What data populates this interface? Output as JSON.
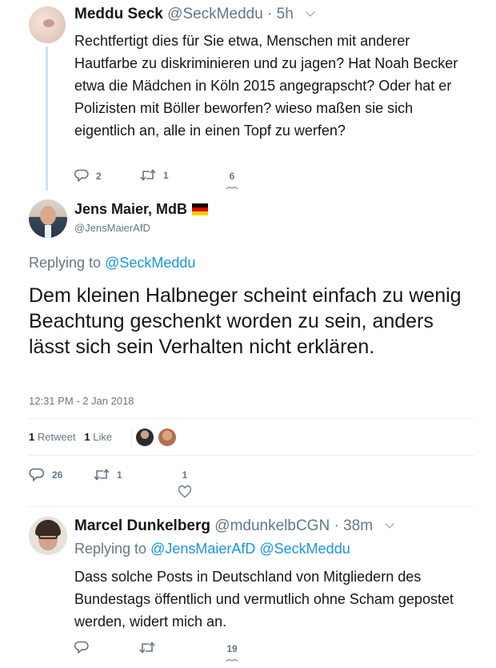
{
  "reply_top": {
    "name": "Meddu Seck",
    "handle": "@SeckMeddu",
    "separator": "·",
    "time": "5h",
    "text": "Rechtfertigt dies für Sie etwa, Menschen mit anderer Hautfarbe zu diskriminieren und zu jagen? Hat Noah Becker etwa die Mädchen in Köln 2015 angegrapscht? Oder hat er Polizisten mit Böller beworfen? wieso maßen sie sich eigentlich an, alle in einen Topf zu werfen?",
    "replies": "2",
    "retweets": "1",
    "likes": "6"
  },
  "main_tweet": {
    "name": "Jens Maier, MdB",
    "handle": "@JensMaierAfD",
    "replying_prefix": "Replying to",
    "replying_handle": "@SeckMeddu",
    "text": "Dem kleinen Halbneger scheint einfach zu wenig Beachtung geschenkt worden zu sein, anders lässt sich sein Verhalten nicht erklären.",
    "timestamp": "12:31 PM - 2 Jan 2018",
    "retweet_count": "1",
    "retweet_label": "Retweet",
    "like_count": "1",
    "like_label": "Like",
    "replies": "26",
    "retweets": "1",
    "likes": "1"
  },
  "reply_bottom": {
    "name": "Marcel Dunkelberg",
    "handle": "@mdunkelbCGN",
    "separator": "·",
    "time": "38m",
    "replying_prefix": "Replying to",
    "replying_handles": "@JensMaierAfD @SeckMeddu",
    "text": "Dass solche Posts in Deutschland von Mitgliedern des Bundestags öffentlich und vermutlich ohne Scham gepostet werden, widert mich an.",
    "likes": "19"
  },
  "colors": {
    "link": "#1b95e0",
    "muted": "#657786",
    "thread_line": "#cde3f7"
  }
}
